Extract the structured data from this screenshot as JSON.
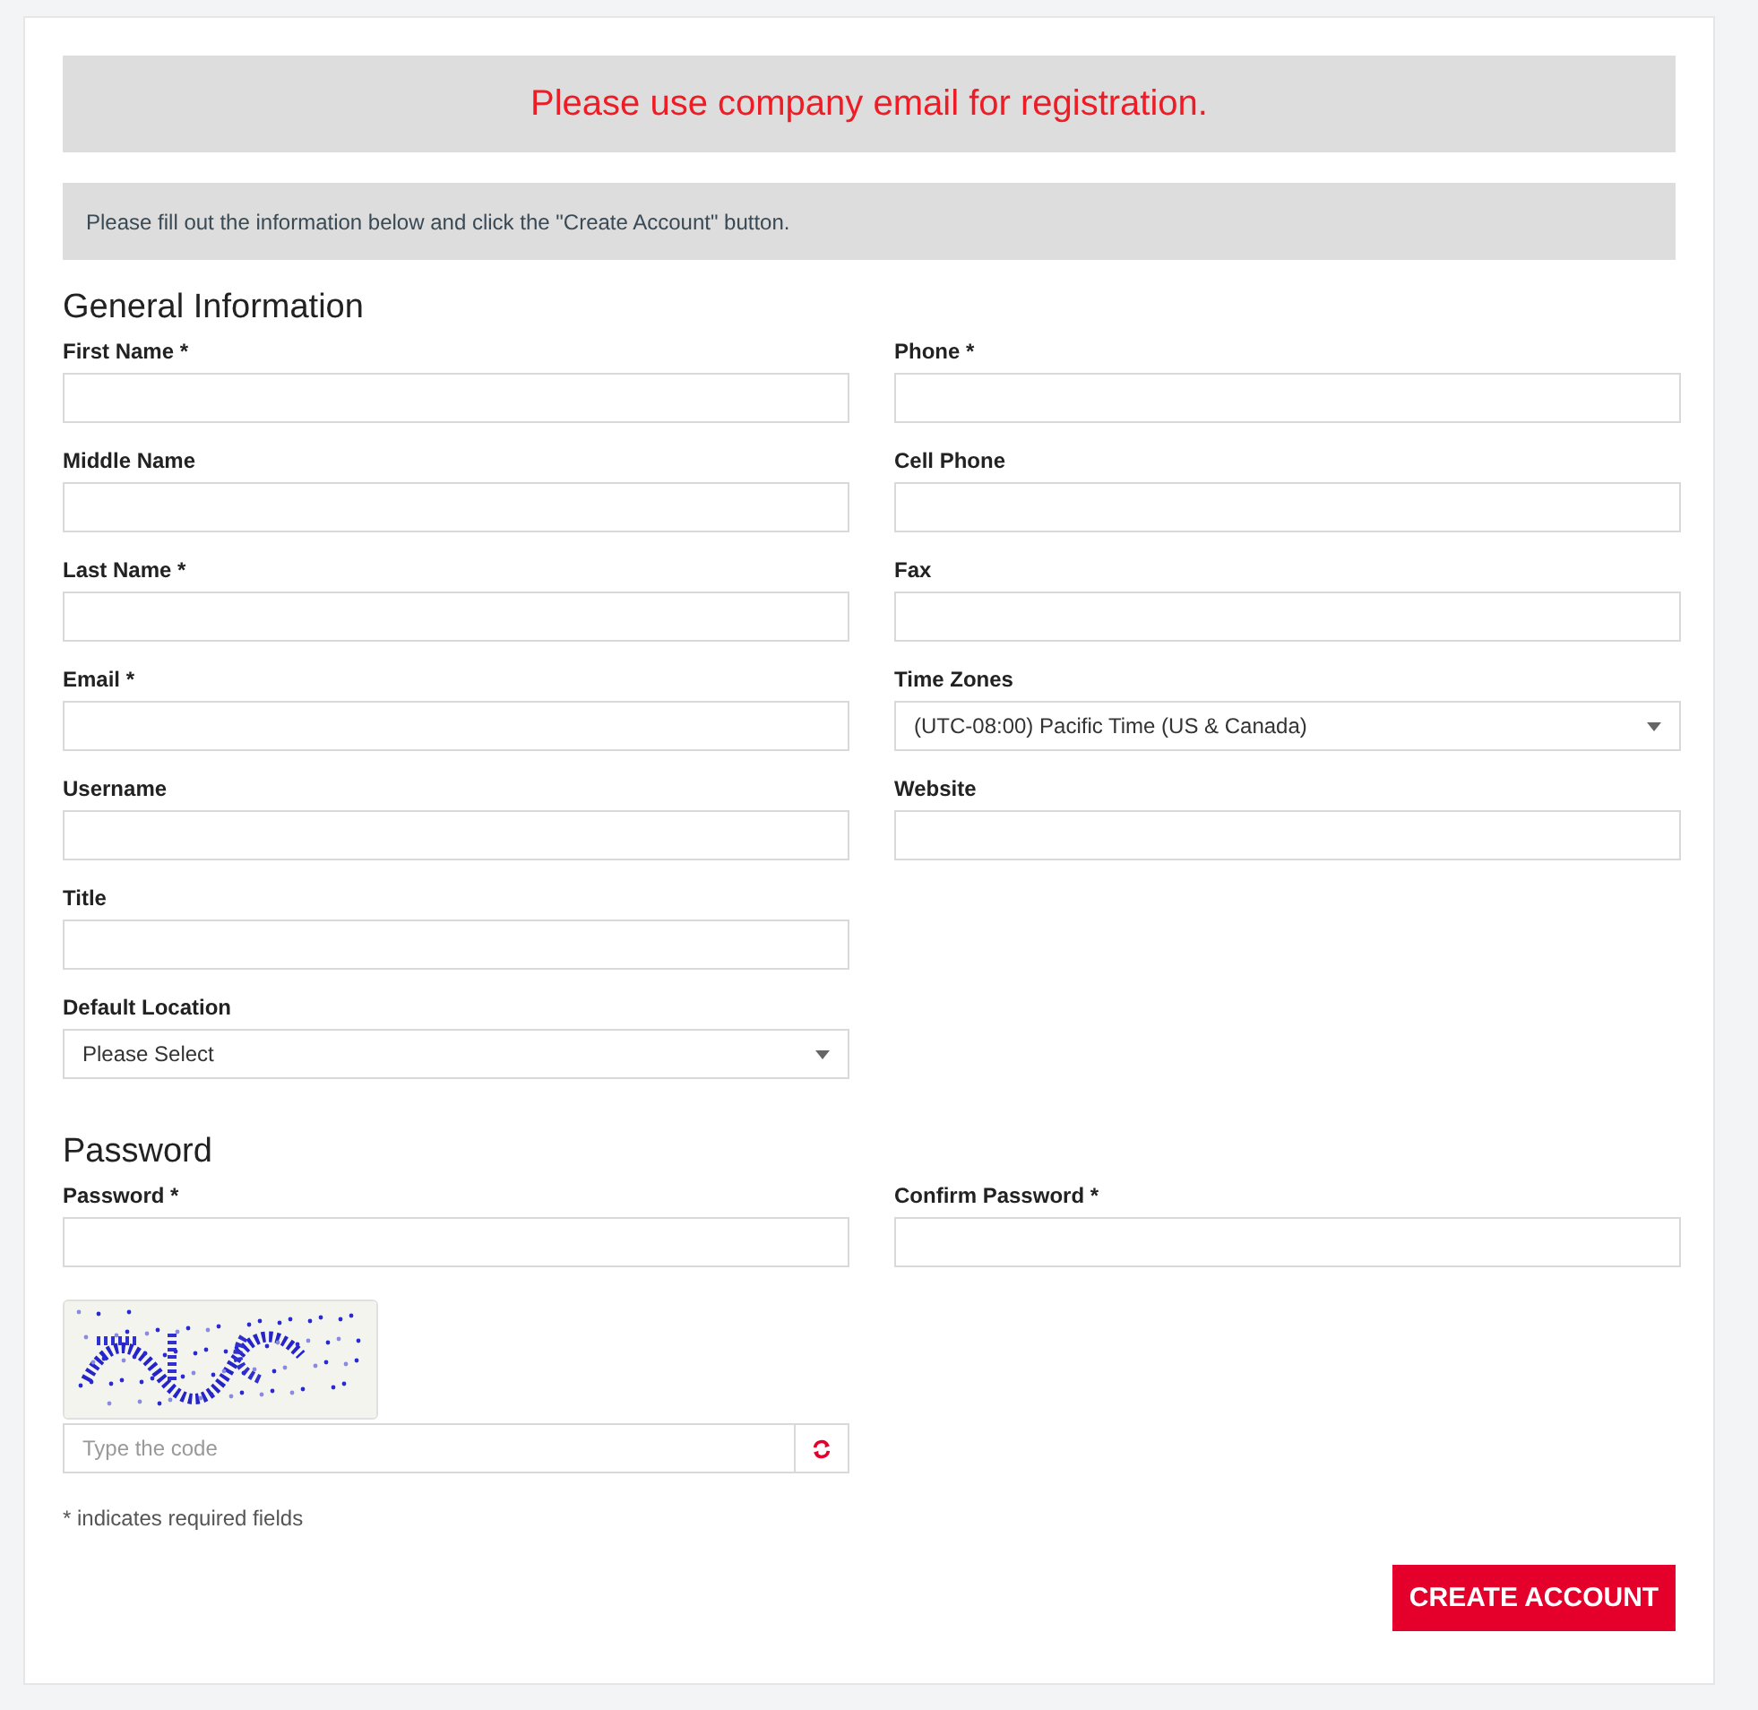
{
  "notice": "Please use company email for registration.",
  "instructions": "Please fill out the information below and click the \"Create Account\" button.",
  "sections": [
    {
      "title": "General Information",
      "columns": [
        [
          {
            "label": "First Name *",
            "kind": "text"
          },
          {
            "label": "Middle Name",
            "kind": "text"
          },
          {
            "label": "Last Name *",
            "kind": "text"
          },
          {
            "label": "Email *",
            "kind": "text"
          },
          {
            "label": "Username",
            "kind": "text"
          },
          {
            "label": "Title",
            "kind": "text"
          },
          {
            "label": "Default Location",
            "kind": "select",
            "value": "Please Select"
          }
        ],
        [
          {
            "label": "Phone *",
            "kind": "text"
          },
          {
            "label": "Cell Phone",
            "kind": "text"
          },
          {
            "label": "Fax",
            "kind": "text"
          },
          {
            "label": "Time Zones",
            "kind": "select",
            "value": "(UTC-08:00) Pacific Time (US & Canada)"
          },
          {
            "label": "Website",
            "kind": "text"
          }
        ]
      ]
    },
    {
      "title": "Password",
      "columns": [
        [
          {
            "label": "Password *",
            "kind": "text"
          }
        ],
        [
          {
            "label": "Confirm Password *",
            "kind": "text"
          }
        ]
      ]
    }
  ],
  "captcha": {
    "kind": "picture",
    "placeholder": "Type the code"
  },
  "required_note": "* indicates required fields",
  "submit_button": "CREATE ACCOUNT"
}
